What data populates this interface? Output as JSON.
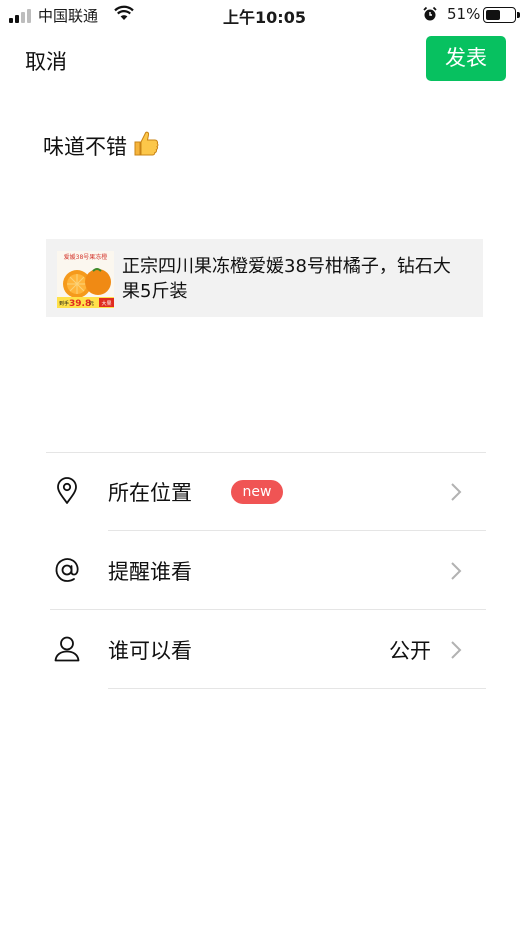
{
  "status_bar": {
    "carrier": "中国联通",
    "time": "上午10:05",
    "battery_percent": "51%",
    "battery_level": 0.51
  },
  "header": {
    "cancel_label": "取消",
    "publish_label": "发表",
    "accent_color": "#07c160"
  },
  "post": {
    "text": "味道不错",
    "emoji": "👍"
  },
  "link_card": {
    "title": "正宗四川果冻橙爱媛38号柑橘子，钻石大果5斤装",
    "thumbnail": {
      "banner_text": "爱媛38号果冻橙",
      "price_prefix": "到手",
      "price": "39.8",
      "price_unit": "元",
      "tag": "大果"
    }
  },
  "options": [
    {
      "icon": "location-pin-icon",
      "label": "所在位置",
      "badge": "new",
      "value": ""
    },
    {
      "icon": "at-sign-icon",
      "label": "提醒谁看",
      "badge": "",
      "value": ""
    },
    {
      "icon": "person-icon",
      "label": "谁可以看",
      "badge": "",
      "value": "公开"
    }
  ]
}
